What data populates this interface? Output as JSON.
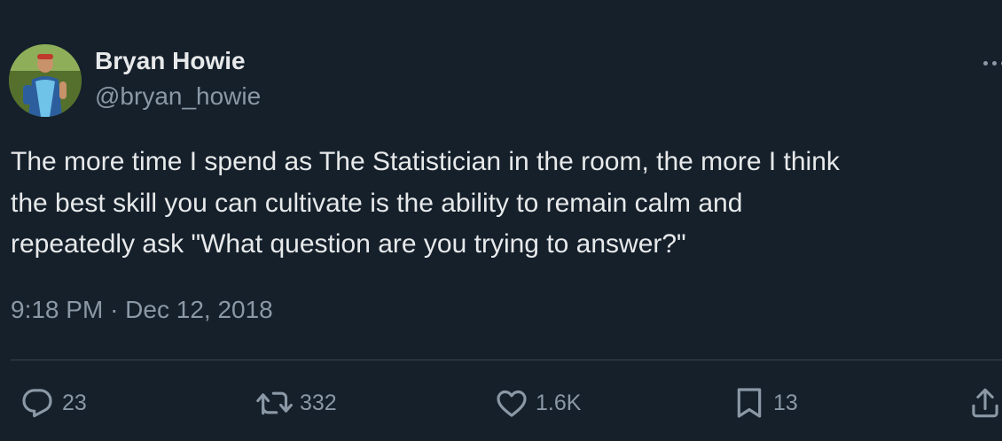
{
  "author": {
    "name": "Bryan Howie",
    "handle": "@bryan_howie"
  },
  "tweet": {
    "lines": [
      "The more time I spend as The Statistician in the room, the more I think",
      "the best skill you can cultivate is the ability to remain calm and",
      "repeatedly ask \"What question are you trying to answer?\""
    ],
    "time": "9:18 PM",
    "separator": "·",
    "date": "Dec 12, 2018"
  },
  "actions": {
    "replies": "23",
    "retweets": "332",
    "likes": "1.6K",
    "bookmarks": "13"
  },
  "icons": {
    "reply": "reply-icon",
    "retweet": "retweet-icon",
    "like": "heart-icon",
    "bookmark": "bookmark-icon",
    "share": "share-icon",
    "more": "more-icon"
  },
  "colors": {
    "background": "#15202b",
    "text_primary": "#e7e9ea",
    "text_secondary": "#8b98a5",
    "divider": "#38444d"
  }
}
